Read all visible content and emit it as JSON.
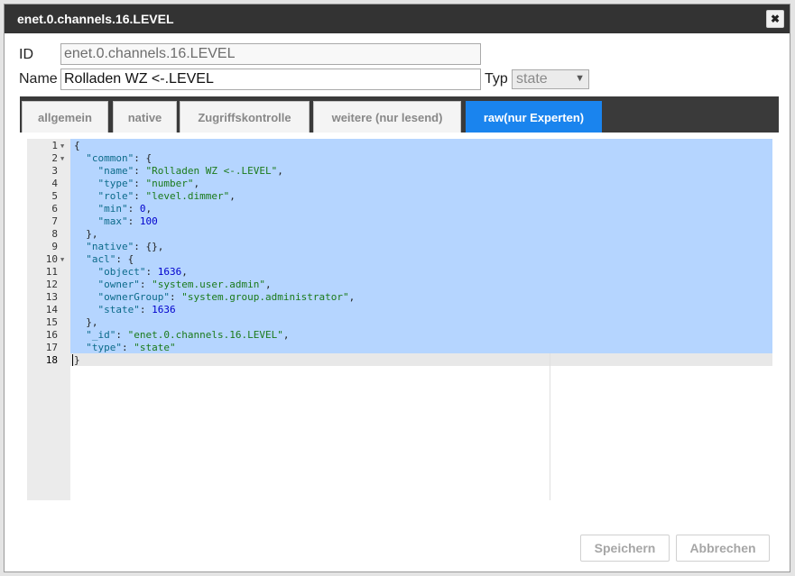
{
  "dialog": {
    "title": "enet.0.channels.16.LEVEL",
    "close_icon": "close-icon"
  },
  "form": {
    "id_label": "ID",
    "id_value": "enet.0.channels.16.LEVEL",
    "name_label": "Name",
    "name_value": "Rolladen WZ <-.LEVEL",
    "type_label": "Typ",
    "type_value": "state"
  },
  "tabs": [
    {
      "label": "allgemein",
      "active": false
    },
    {
      "label": "native",
      "active": false
    },
    {
      "label": "Zugriffskontrolle",
      "active": false
    },
    {
      "label": "weitere (nur lesend)",
      "active": false
    },
    {
      "label": "raw(nur Experten)",
      "active": true
    }
  ],
  "editor": {
    "lines": [
      {
        "n": "1",
        "fold": true,
        "code": [
          [
            "p",
            "{"
          ]
        ]
      },
      {
        "n": "2",
        "fold": true,
        "code": [
          [
            "p",
            "  "
          ],
          [
            "k",
            "\"common\""
          ],
          [
            "p",
            ": {"
          ]
        ]
      },
      {
        "n": "3",
        "fold": false,
        "code": [
          [
            "p",
            "    "
          ],
          [
            "k",
            "\"name\""
          ],
          [
            "p",
            ": "
          ],
          [
            "s",
            "\"Rolladen WZ <-.LEVEL\""
          ],
          [
            "p",
            ","
          ]
        ]
      },
      {
        "n": "4",
        "fold": false,
        "code": [
          [
            "p",
            "    "
          ],
          [
            "k",
            "\"type\""
          ],
          [
            "p",
            ": "
          ],
          [
            "s",
            "\"number\""
          ],
          [
            "p",
            ","
          ]
        ]
      },
      {
        "n": "5",
        "fold": false,
        "code": [
          [
            "p",
            "    "
          ],
          [
            "k",
            "\"role\""
          ],
          [
            "p",
            ": "
          ],
          [
            "s",
            "\"level.dimmer\""
          ],
          [
            "p",
            ","
          ]
        ]
      },
      {
        "n": "6",
        "fold": false,
        "code": [
          [
            "p",
            "    "
          ],
          [
            "k",
            "\"min\""
          ],
          [
            "p",
            ": "
          ],
          [
            "n",
            "0"
          ],
          [
            "p",
            ","
          ]
        ]
      },
      {
        "n": "7",
        "fold": false,
        "code": [
          [
            "p",
            "    "
          ],
          [
            "k",
            "\"max\""
          ],
          [
            "p",
            ": "
          ],
          [
            "n",
            "100"
          ]
        ]
      },
      {
        "n": "8",
        "fold": false,
        "code": [
          [
            "p",
            "  },"
          ]
        ]
      },
      {
        "n": "9",
        "fold": false,
        "code": [
          [
            "p",
            "  "
          ],
          [
            "k",
            "\"native\""
          ],
          [
            "p",
            ": {},"
          ]
        ]
      },
      {
        "n": "10",
        "fold": true,
        "code": [
          [
            "p",
            "  "
          ],
          [
            "k",
            "\"acl\""
          ],
          [
            "p",
            ": {"
          ]
        ]
      },
      {
        "n": "11",
        "fold": false,
        "code": [
          [
            "p",
            "    "
          ],
          [
            "k",
            "\"object\""
          ],
          [
            "p",
            ": "
          ],
          [
            "n",
            "1636"
          ],
          [
            "p",
            ","
          ]
        ]
      },
      {
        "n": "12",
        "fold": false,
        "code": [
          [
            "p",
            "    "
          ],
          [
            "k",
            "\"owner\""
          ],
          [
            "p",
            ": "
          ],
          [
            "s",
            "\"system.user.admin\""
          ],
          [
            "p",
            ","
          ]
        ]
      },
      {
        "n": "13",
        "fold": false,
        "code": [
          [
            "p",
            "    "
          ],
          [
            "k",
            "\"ownerGroup\""
          ],
          [
            "p",
            ": "
          ],
          [
            "s",
            "\"system.group.administrator\""
          ],
          [
            "p",
            ","
          ]
        ]
      },
      {
        "n": "14",
        "fold": false,
        "code": [
          [
            "p",
            "    "
          ],
          [
            "k",
            "\"state\""
          ],
          [
            "p",
            ": "
          ],
          [
            "n",
            "1636"
          ]
        ]
      },
      {
        "n": "15",
        "fold": false,
        "code": [
          [
            "p",
            "  },"
          ]
        ]
      },
      {
        "n": "16",
        "fold": false,
        "code": [
          [
            "p",
            "  "
          ],
          [
            "k",
            "\"_id\""
          ],
          [
            "p",
            ": "
          ],
          [
            "s",
            "\"enet.0.channels.16.LEVEL\""
          ],
          [
            "p",
            ","
          ]
        ]
      },
      {
        "n": "17",
        "fold": false,
        "code": [
          [
            "p",
            "  "
          ],
          [
            "k",
            "\"type\""
          ],
          [
            "p",
            ": "
          ],
          [
            "s",
            "\"state\""
          ]
        ]
      },
      {
        "n": "18",
        "fold": false,
        "code": [
          [
            "p",
            "}"
          ]
        ]
      }
    ]
  },
  "buttons": {
    "save_label": "Speichern",
    "cancel_label": "Abbrechen"
  }
}
